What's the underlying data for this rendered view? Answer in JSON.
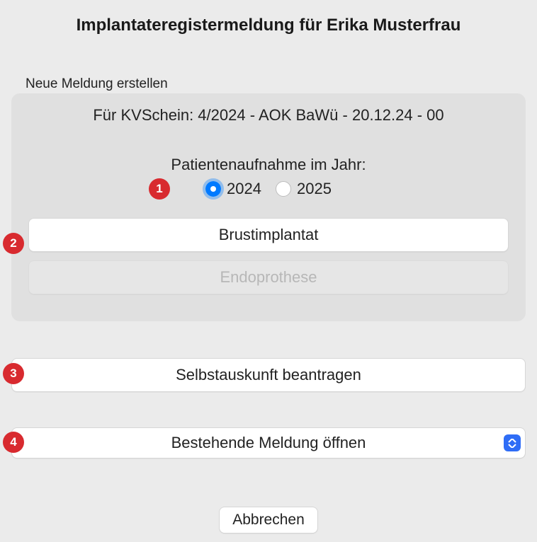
{
  "title": "Implantateregistermeldung für Erika Musterfrau",
  "section_label": "Neue Meldung erstellen",
  "kv_line": "Für KVSchein: 4/2024 - AOK BaWü - 20.12.24 - 00",
  "year_label": "Patientenaufnahme im Jahr:",
  "year_options": {
    "opt1": "2024",
    "opt2": "2025",
    "selected": "2024"
  },
  "buttons": {
    "brust": "Brustimplantat",
    "endo": "Endoprothese",
    "selbst": "Selbstauskunft beantragen",
    "open": "Bestehende Meldung öffnen",
    "cancel": "Abbrechen"
  },
  "markers": {
    "m1": "1",
    "m2": "2",
    "m3": "3",
    "m4": "4"
  }
}
